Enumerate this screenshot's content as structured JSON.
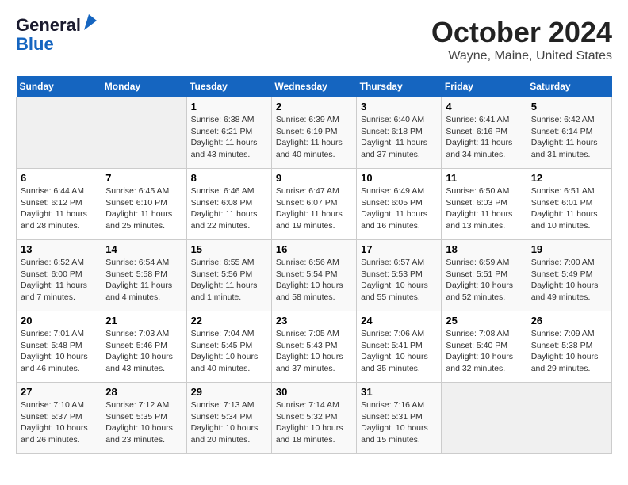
{
  "header": {
    "logo_line1": "General",
    "logo_line2": "Blue",
    "title": "October 2024",
    "subtitle": "Wayne, Maine, United States"
  },
  "weekdays": [
    "Sunday",
    "Monday",
    "Tuesday",
    "Wednesday",
    "Thursday",
    "Friday",
    "Saturday"
  ],
  "weeks": [
    [
      {
        "empty": true
      },
      {
        "empty": true
      },
      {
        "day": "1",
        "sunrise": "6:38 AM",
        "sunset": "6:21 PM",
        "daylight": "11 hours and 43 minutes."
      },
      {
        "day": "2",
        "sunrise": "6:39 AM",
        "sunset": "6:19 PM",
        "daylight": "11 hours and 40 minutes."
      },
      {
        "day": "3",
        "sunrise": "6:40 AM",
        "sunset": "6:18 PM",
        "daylight": "11 hours and 37 minutes."
      },
      {
        "day": "4",
        "sunrise": "6:41 AM",
        "sunset": "6:16 PM",
        "daylight": "11 hours and 34 minutes."
      },
      {
        "day": "5",
        "sunrise": "6:42 AM",
        "sunset": "6:14 PM",
        "daylight": "11 hours and 31 minutes."
      }
    ],
    [
      {
        "day": "6",
        "sunrise": "6:44 AM",
        "sunset": "6:12 PM",
        "daylight": "11 hours and 28 minutes."
      },
      {
        "day": "7",
        "sunrise": "6:45 AM",
        "sunset": "6:10 PM",
        "daylight": "11 hours and 25 minutes."
      },
      {
        "day": "8",
        "sunrise": "6:46 AM",
        "sunset": "6:08 PM",
        "daylight": "11 hours and 22 minutes."
      },
      {
        "day": "9",
        "sunrise": "6:47 AM",
        "sunset": "6:07 PM",
        "daylight": "11 hours and 19 minutes."
      },
      {
        "day": "10",
        "sunrise": "6:49 AM",
        "sunset": "6:05 PM",
        "daylight": "11 hours and 16 minutes."
      },
      {
        "day": "11",
        "sunrise": "6:50 AM",
        "sunset": "6:03 PM",
        "daylight": "11 hours and 13 minutes."
      },
      {
        "day": "12",
        "sunrise": "6:51 AM",
        "sunset": "6:01 PM",
        "daylight": "11 hours and 10 minutes."
      }
    ],
    [
      {
        "day": "13",
        "sunrise": "6:52 AM",
        "sunset": "6:00 PM",
        "daylight": "11 hours and 7 minutes."
      },
      {
        "day": "14",
        "sunrise": "6:54 AM",
        "sunset": "5:58 PM",
        "daylight": "11 hours and 4 minutes."
      },
      {
        "day": "15",
        "sunrise": "6:55 AM",
        "sunset": "5:56 PM",
        "daylight": "11 hours and 1 minute."
      },
      {
        "day": "16",
        "sunrise": "6:56 AM",
        "sunset": "5:54 PM",
        "daylight": "10 hours and 58 minutes."
      },
      {
        "day": "17",
        "sunrise": "6:57 AM",
        "sunset": "5:53 PM",
        "daylight": "10 hours and 55 minutes."
      },
      {
        "day": "18",
        "sunrise": "6:59 AM",
        "sunset": "5:51 PM",
        "daylight": "10 hours and 52 minutes."
      },
      {
        "day": "19",
        "sunrise": "7:00 AM",
        "sunset": "5:49 PM",
        "daylight": "10 hours and 49 minutes."
      }
    ],
    [
      {
        "day": "20",
        "sunrise": "7:01 AM",
        "sunset": "5:48 PM",
        "daylight": "10 hours and 46 minutes."
      },
      {
        "day": "21",
        "sunrise": "7:03 AM",
        "sunset": "5:46 PM",
        "daylight": "10 hours and 43 minutes."
      },
      {
        "day": "22",
        "sunrise": "7:04 AM",
        "sunset": "5:45 PM",
        "daylight": "10 hours and 40 minutes."
      },
      {
        "day": "23",
        "sunrise": "7:05 AM",
        "sunset": "5:43 PM",
        "daylight": "10 hours and 37 minutes."
      },
      {
        "day": "24",
        "sunrise": "7:06 AM",
        "sunset": "5:41 PM",
        "daylight": "10 hours and 35 minutes."
      },
      {
        "day": "25",
        "sunrise": "7:08 AM",
        "sunset": "5:40 PM",
        "daylight": "10 hours and 32 minutes."
      },
      {
        "day": "26",
        "sunrise": "7:09 AM",
        "sunset": "5:38 PM",
        "daylight": "10 hours and 29 minutes."
      }
    ],
    [
      {
        "day": "27",
        "sunrise": "7:10 AM",
        "sunset": "5:37 PM",
        "daylight": "10 hours and 26 minutes."
      },
      {
        "day": "28",
        "sunrise": "7:12 AM",
        "sunset": "5:35 PM",
        "daylight": "10 hours and 23 minutes."
      },
      {
        "day": "29",
        "sunrise": "7:13 AM",
        "sunset": "5:34 PM",
        "daylight": "10 hours and 20 minutes."
      },
      {
        "day": "30",
        "sunrise": "7:14 AM",
        "sunset": "5:32 PM",
        "daylight": "10 hours and 18 minutes."
      },
      {
        "day": "31",
        "sunrise": "7:16 AM",
        "sunset": "5:31 PM",
        "daylight": "10 hours and 15 minutes."
      },
      {
        "empty": true
      },
      {
        "empty": true
      }
    ]
  ],
  "labels": {
    "sunrise": "Sunrise:",
    "sunset": "Sunset:",
    "daylight": "Daylight:"
  }
}
